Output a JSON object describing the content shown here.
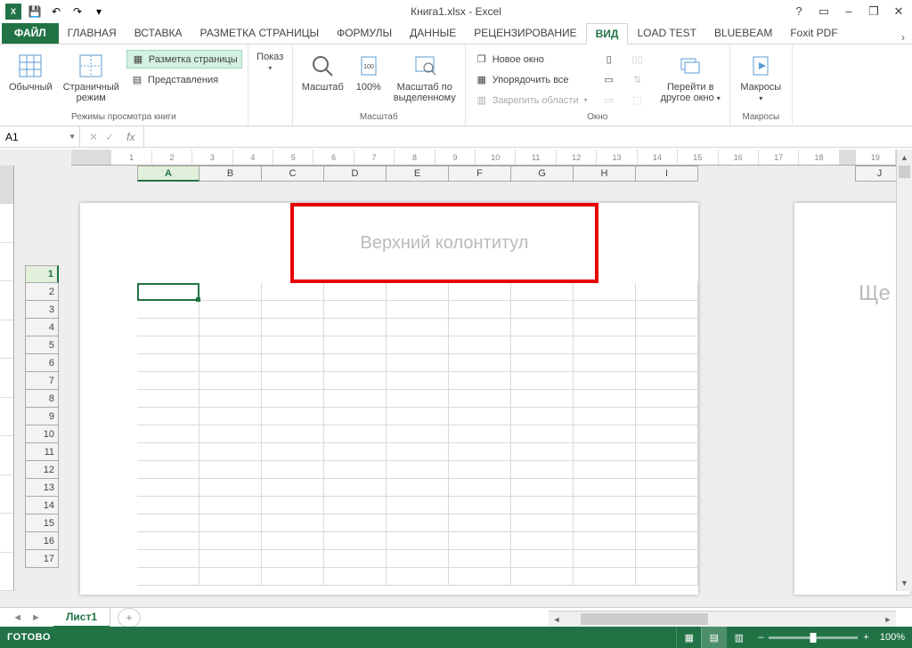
{
  "title": "Книга1.xlsx - Excel",
  "qat": {
    "save": "💾",
    "undo": "↶",
    "redo": "↷"
  },
  "wincontrols": {
    "help": "?",
    "ribbonopts": "▭",
    "min": "–",
    "restore": "❐",
    "close": "✕"
  },
  "tabs": {
    "file": "ФАЙЛ",
    "items": [
      "ГЛАВНАЯ",
      "ВСТАВКА",
      "РАЗМЕТКА СТРАНИЦЫ",
      "ФОРМУЛЫ",
      "ДАННЫЕ",
      "РЕЦЕНЗИРОВАНИЕ",
      "ВИД",
      "LOAD TEST",
      "BLUEBEAM",
      "Foxit PDF"
    ],
    "active": "ВИД",
    "overflow": "›"
  },
  "ribbon": {
    "views": {
      "normal": "Обычный",
      "pagebreak": "Страничный\nрежим",
      "pagelayout": "Разметка страницы",
      "custom": "Представления",
      "group_label": "Режимы просмотра книги"
    },
    "show": {
      "btn": "Показ",
      "dd": "▾"
    },
    "zoom": {
      "zoom": "Масштаб",
      "hundred": "100%",
      "selection": "Масштаб по\nвыделенному",
      "group_label": "Масштаб"
    },
    "window": {
      "new": "Новое окно",
      "arrange": "Упорядочить все",
      "freeze": "Закрепить области",
      "dd": "▾",
      "switch": "Перейти в\nдругое окно",
      "group_label": "Окно"
    },
    "macros": {
      "btn": "Макросы",
      "group_label": "Макросы",
      "dd": "▾"
    }
  },
  "namebox": "A1",
  "fx": {
    "cancel": "✕",
    "ok": "✓",
    "fx": "fx"
  },
  "columns": [
    "A",
    "B",
    "C",
    "D",
    "E",
    "F",
    "G",
    "H",
    "I"
  ],
  "columns2": [
    "J"
  ],
  "rows": [
    "1",
    "2",
    "3",
    "4",
    "5",
    "6",
    "7",
    "8",
    "9",
    "10",
    "11",
    "12",
    "13",
    "14",
    "15",
    "16",
    "17"
  ],
  "hruler": [
    "1",
    "2",
    "3",
    "4",
    "5",
    "6",
    "7",
    "8",
    "9",
    "10",
    "11",
    "12",
    "13",
    "14",
    "15",
    "16",
    "17",
    "18",
    "",
    "19"
  ],
  "header_placeholder": "Верхний колонтитул",
  "page2_text": "Ще",
  "sheet": {
    "name": "Лист1",
    "add": "+",
    "nav_l": "◄",
    "nav_r": "►"
  },
  "status": {
    "ready": "ГОТОВО",
    "zoom": "100%",
    "minus": "–",
    "plus": "+"
  }
}
